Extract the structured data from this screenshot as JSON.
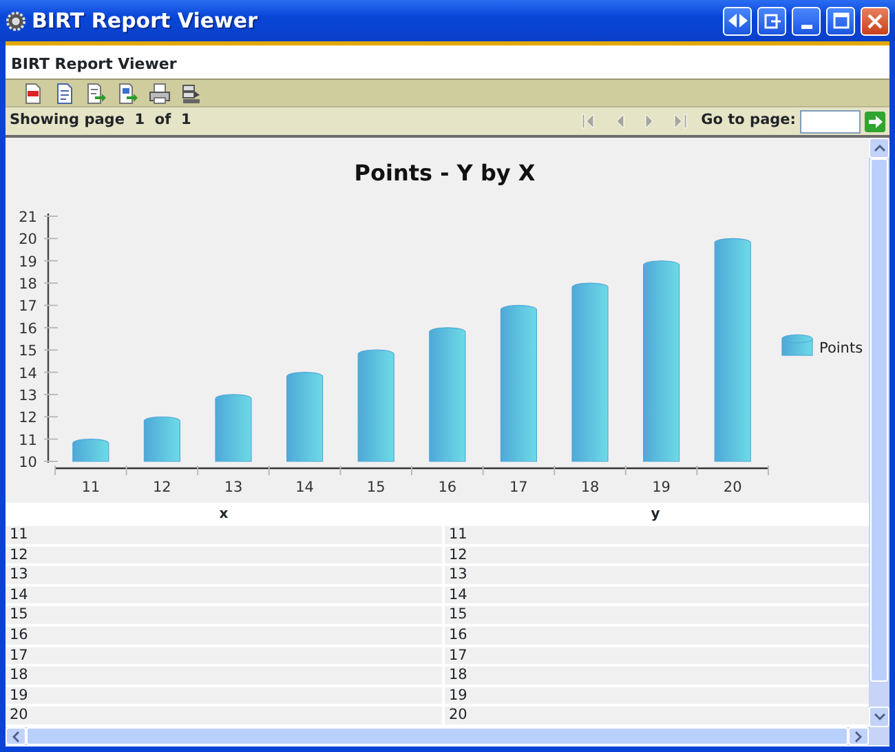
{
  "window": {
    "title": "BIRT Report Viewer"
  },
  "header": {
    "title": "BIRT Report Viewer"
  },
  "navigation": {
    "status": "Showing page  1  of  1",
    "buttons": [
      {
        "kind": "first",
        "disabled": true
      },
      {
        "kind": "previous",
        "disabled": true
      },
      {
        "kind": "next",
        "disabled": true
      },
      {
        "kind": "last",
        "disabled": true
      }
    ],
    "goto_label": "Go to page:"
  },
  "report": {
    "chart_data": {
      "type": "bar",
      "title": "Points - Y by X",
      "categories": [
        "11",
        "12",
        "13",
        "14",
        "15",
        "16",
        "17",
        "18",
        "19",
        "20"
      ],
      "series": [
        {
          "name": "Points",
          "color": "#4fa8d8",
          "values": [
            11,
            12,
            13,
            14,
            15,
            16,
            17,
            18,
            19,
            20
          ]
        }
      ],
      "ylim": [
        10,
        21
      ],
      "yticks": [
        10,
        11,
        12,
        13,
        14,
        15,
        16,
        17,
        18,
        19,
        20,
        21
      ]
    },
    "table": {
      "columns": [
        "x",
        "y"
      ],
      "rows": [
        [
          "11",
          "11"
        ],
        [
          "12",
          "12"
        ],
        [
          "13",
          "13"
        ],
        [
          "14",
          "14"
        ],
        [
          "15",
          "15"
        ],
        [
          "16",
          "16"
        ],
        [
          "17",
          "17"
        ],
        [
          "18",
          "18"
        ],
        [
          "19",
          "19"
        ],
        [
          "20",
          "20"
        ]
      ]
    }
  }
}
